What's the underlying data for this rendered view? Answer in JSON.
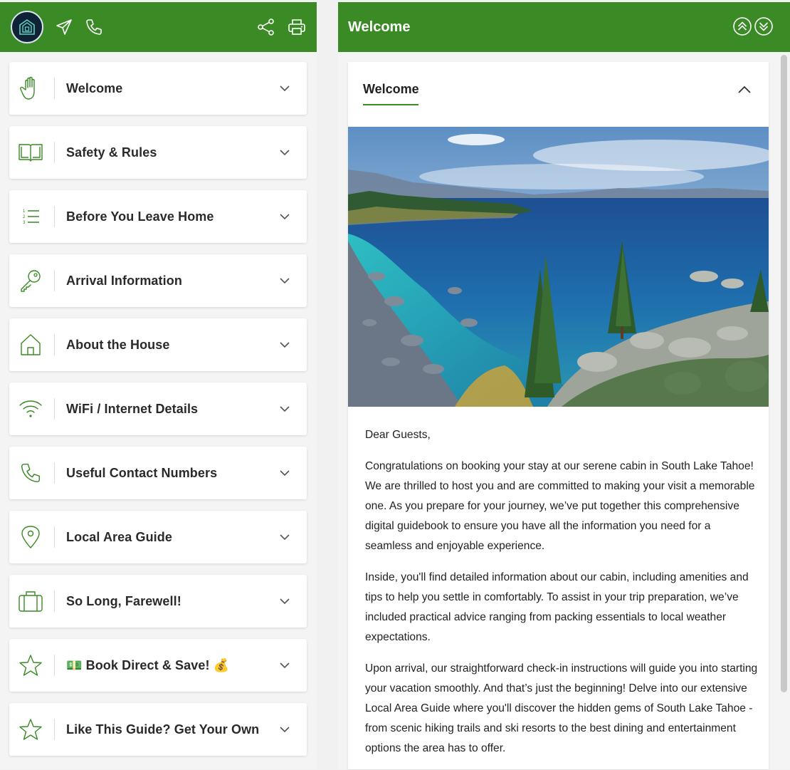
{
  "left_panel": {
    "header_icons": [
      "home-logo-icon",
      "send-icon",
      "phone-icon",
      "share-icon",
      "printer-icon"
    ],
    "menu_items": [
      {
        "label": "Welcome",
        "icon": "hand-icon"
      },
      {
        "label": "Safety & Rules",
        "icon": "book-icon"
      },
      {
        "label": "Before You Leave Home",
        "icon": "numbered-list-icon"
      },
      {
        "label": "Arrival Information",
        "icon": "key-icon"
      },
      {
        "label": "About the House",
        "icon": "house-icon"
      },
      {
        "label": "WiFi / Internet Details",
        "icon": "wifi-icon"
      },
      {
        "label": "Useful Contact Numbers",
        "icon": "phone-icon"
      },
      {
        "label": "Local Area Guide",
        "icon": "map-pin-icon"
      },
      {
        "label": "So Long, Farewell!",
        "icon": "suitcase-icon"
      },
      {
        "label": "💵 Book Direct & Save! 💰",
        "icon": "star-icon"
      },
      {
        "label": "Like This Guide? Get Your Own",
        "icon": "star-icon"
      }
    ]
  },
  "right_panel": {
    "title": "Welcome",
    "section_title": "Welcome",
    "paragraphs": [
      "Dear Guests,",
      "Congratulations on booking your stay at our serene cabin in South Lake Tahoe! We are thrilled to host you and are committed to making your visit a memorable one. As you prepare for your journey, we’ve put together this comprehensive digital guidebook to ensure you have all the information you need for a seamless and enjoyable experience.",
      "Inside, you'll find detailed information about our cabin, including amenities and tips to help you settle in comfortably. To assist in your trip preparation, we’ve included practical advice ranging from packing essentials to local weather expectations.",
      "Upon arrival, our straightforward check-in instructions will guide you into starting your vacation smoothly. And that’s just the beginning! Delve into our extensive Local Area Guide where you'll discover the hidden gems of South Lake Tahoe - from scenic hiking trails and ski resorts to the best dining and entertainment options the area has to offer."
    ]
  },
  "colors": {
    "brand_green": "#3a8a25",
    "icon_green": "#3a8a25",
    "logo_navy": "#0f2236"
  }
}
